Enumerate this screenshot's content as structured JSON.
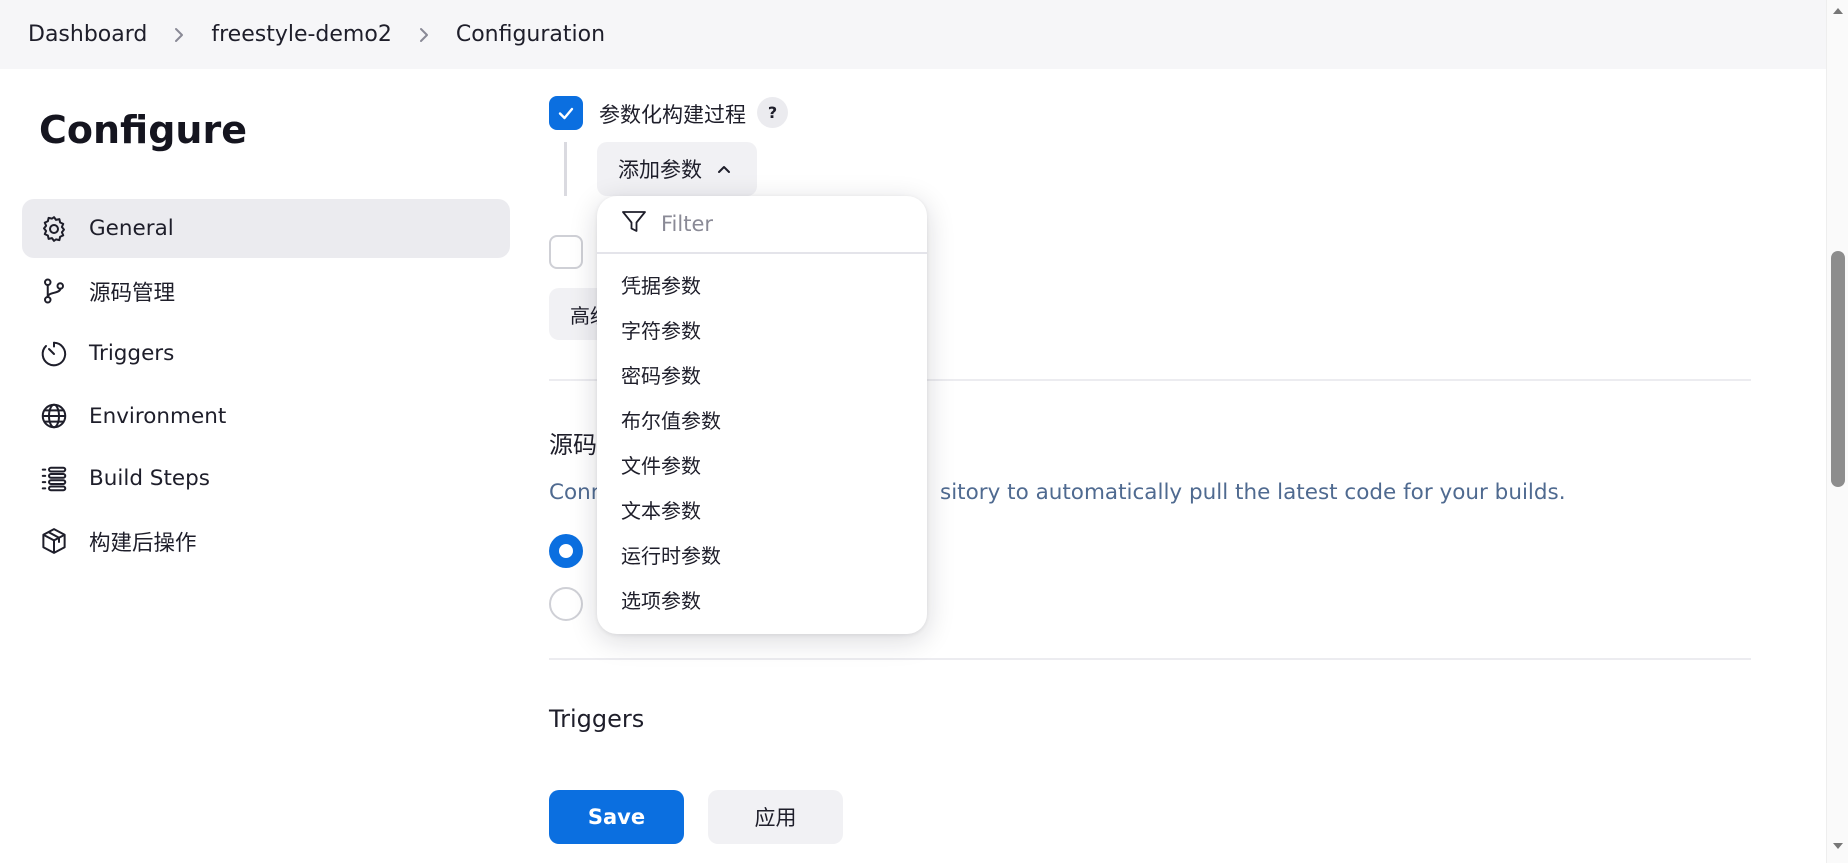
{
  "breadcrumb": {
    "items": [
      {
        "label": "Dashboard"
      },
      {
        "label": "freestyle-demo2"
      },
      {
        "label": "Configuration"
      }
    ]
  },
  "sidebar": {
    "title": "Configure",
    "items": [
      {
        "label": "General",
        "icon": "gear-icon",
        "active": true
      },
      {
        "label": "源码管理",
        "icon": "git-branch-icon"
      },
      {
        "label": "Triggers",
        "icon": "timer-icon"
      },
      {
        "label": "Environment",
        "icon": "globe-icon"
      },
      {
        "label": "Build Steps",
        "icon": "list-icon"
      },
      {
        "label": "构建后操作",
        "icon": "package-icon"
      }
    ]
  },
  "general": {
    "parameterized_label": "参数化构建过程",
    "parameterized_checked": true,
    "help": "?",
    "add_parameter_label": "添加参数",
    "advanced_label": "高级"
  },
  "dropdown": {
    "filter_placeholder": "Filter",
    "items": [
      "凭据参数",
      "字符参数",
      "密码参数",
      "布尔值参数",
      "文件参数",
      "文本参数",
      "运行时参数",
      "选项参数"
    ]
  },
  "scm": {
    "title_partial": "源码",
    "desc_left": "Conn",
    "desc_right": "sitory to automatically pull the latest code for your builds."
  },
  "triggers": {
    "title": "Triggers"
  },
  "actions": {
    "save_label": "Save",
    "apply_label": "应用"
  },
  "colors": {
    "accent": "#0b6fe0",
    "header_bg": "#f6f6f8",
    "description_text": "#4f6a90"
  }
}
